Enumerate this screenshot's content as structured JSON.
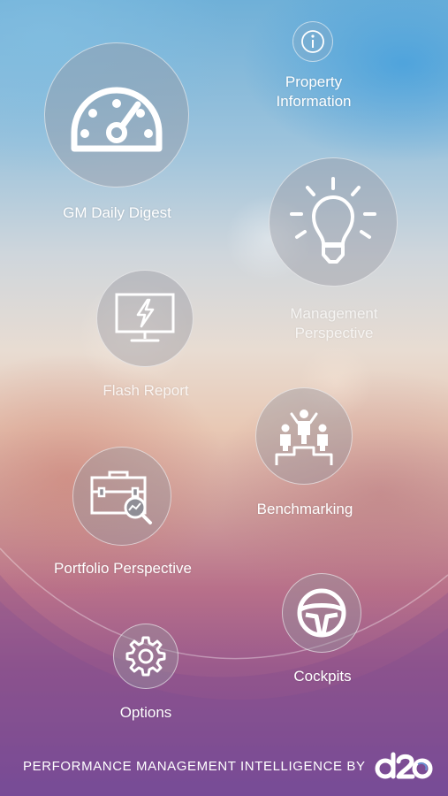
{
  "menu": {
    "gm_daily_digest": {
      "label": "GM Daily Digest",
      "icon": "speedometer-icon"
    },
    "property_information": {
      "label_line1": "Property",
      "label_line2": "Information",
      "icon": "info-icon"
    },
    "management_perspective": {
      "label_line1": "Management",
      "label_line2": "Perspective",
      "icon": "lightbulb-icon"
    },
    "flash_report": {
      "label": "Flash Report",
      "icon": "monitor-lightning-icon"
    },
    "benchmarking": {
      "label": "Benchmarking",
      "icon": "podium-people-icon"
    },
    "portfolio_perspective": {
      "label": "Portfolio Perspective",
      "icon": "briefcase-search-icon"
    },
    "cockpits": {
      "label": "Cockpits",
      "icon": "steering-wheel-icon"
    },
    "options": {
      "label": "Options",
      "icon": "gear-icon"
    }
  },
  "footer": {
    "tagline": "PERFORMANCE MANAGEMENT INTELLIGENCE BY",
    "brand_logo": "d2o"
  },
  "colors": {
    "icon_stroke": "#ffffff",
    "circle_fill": "rgba(150,150,160,0.42)"
  }
}
